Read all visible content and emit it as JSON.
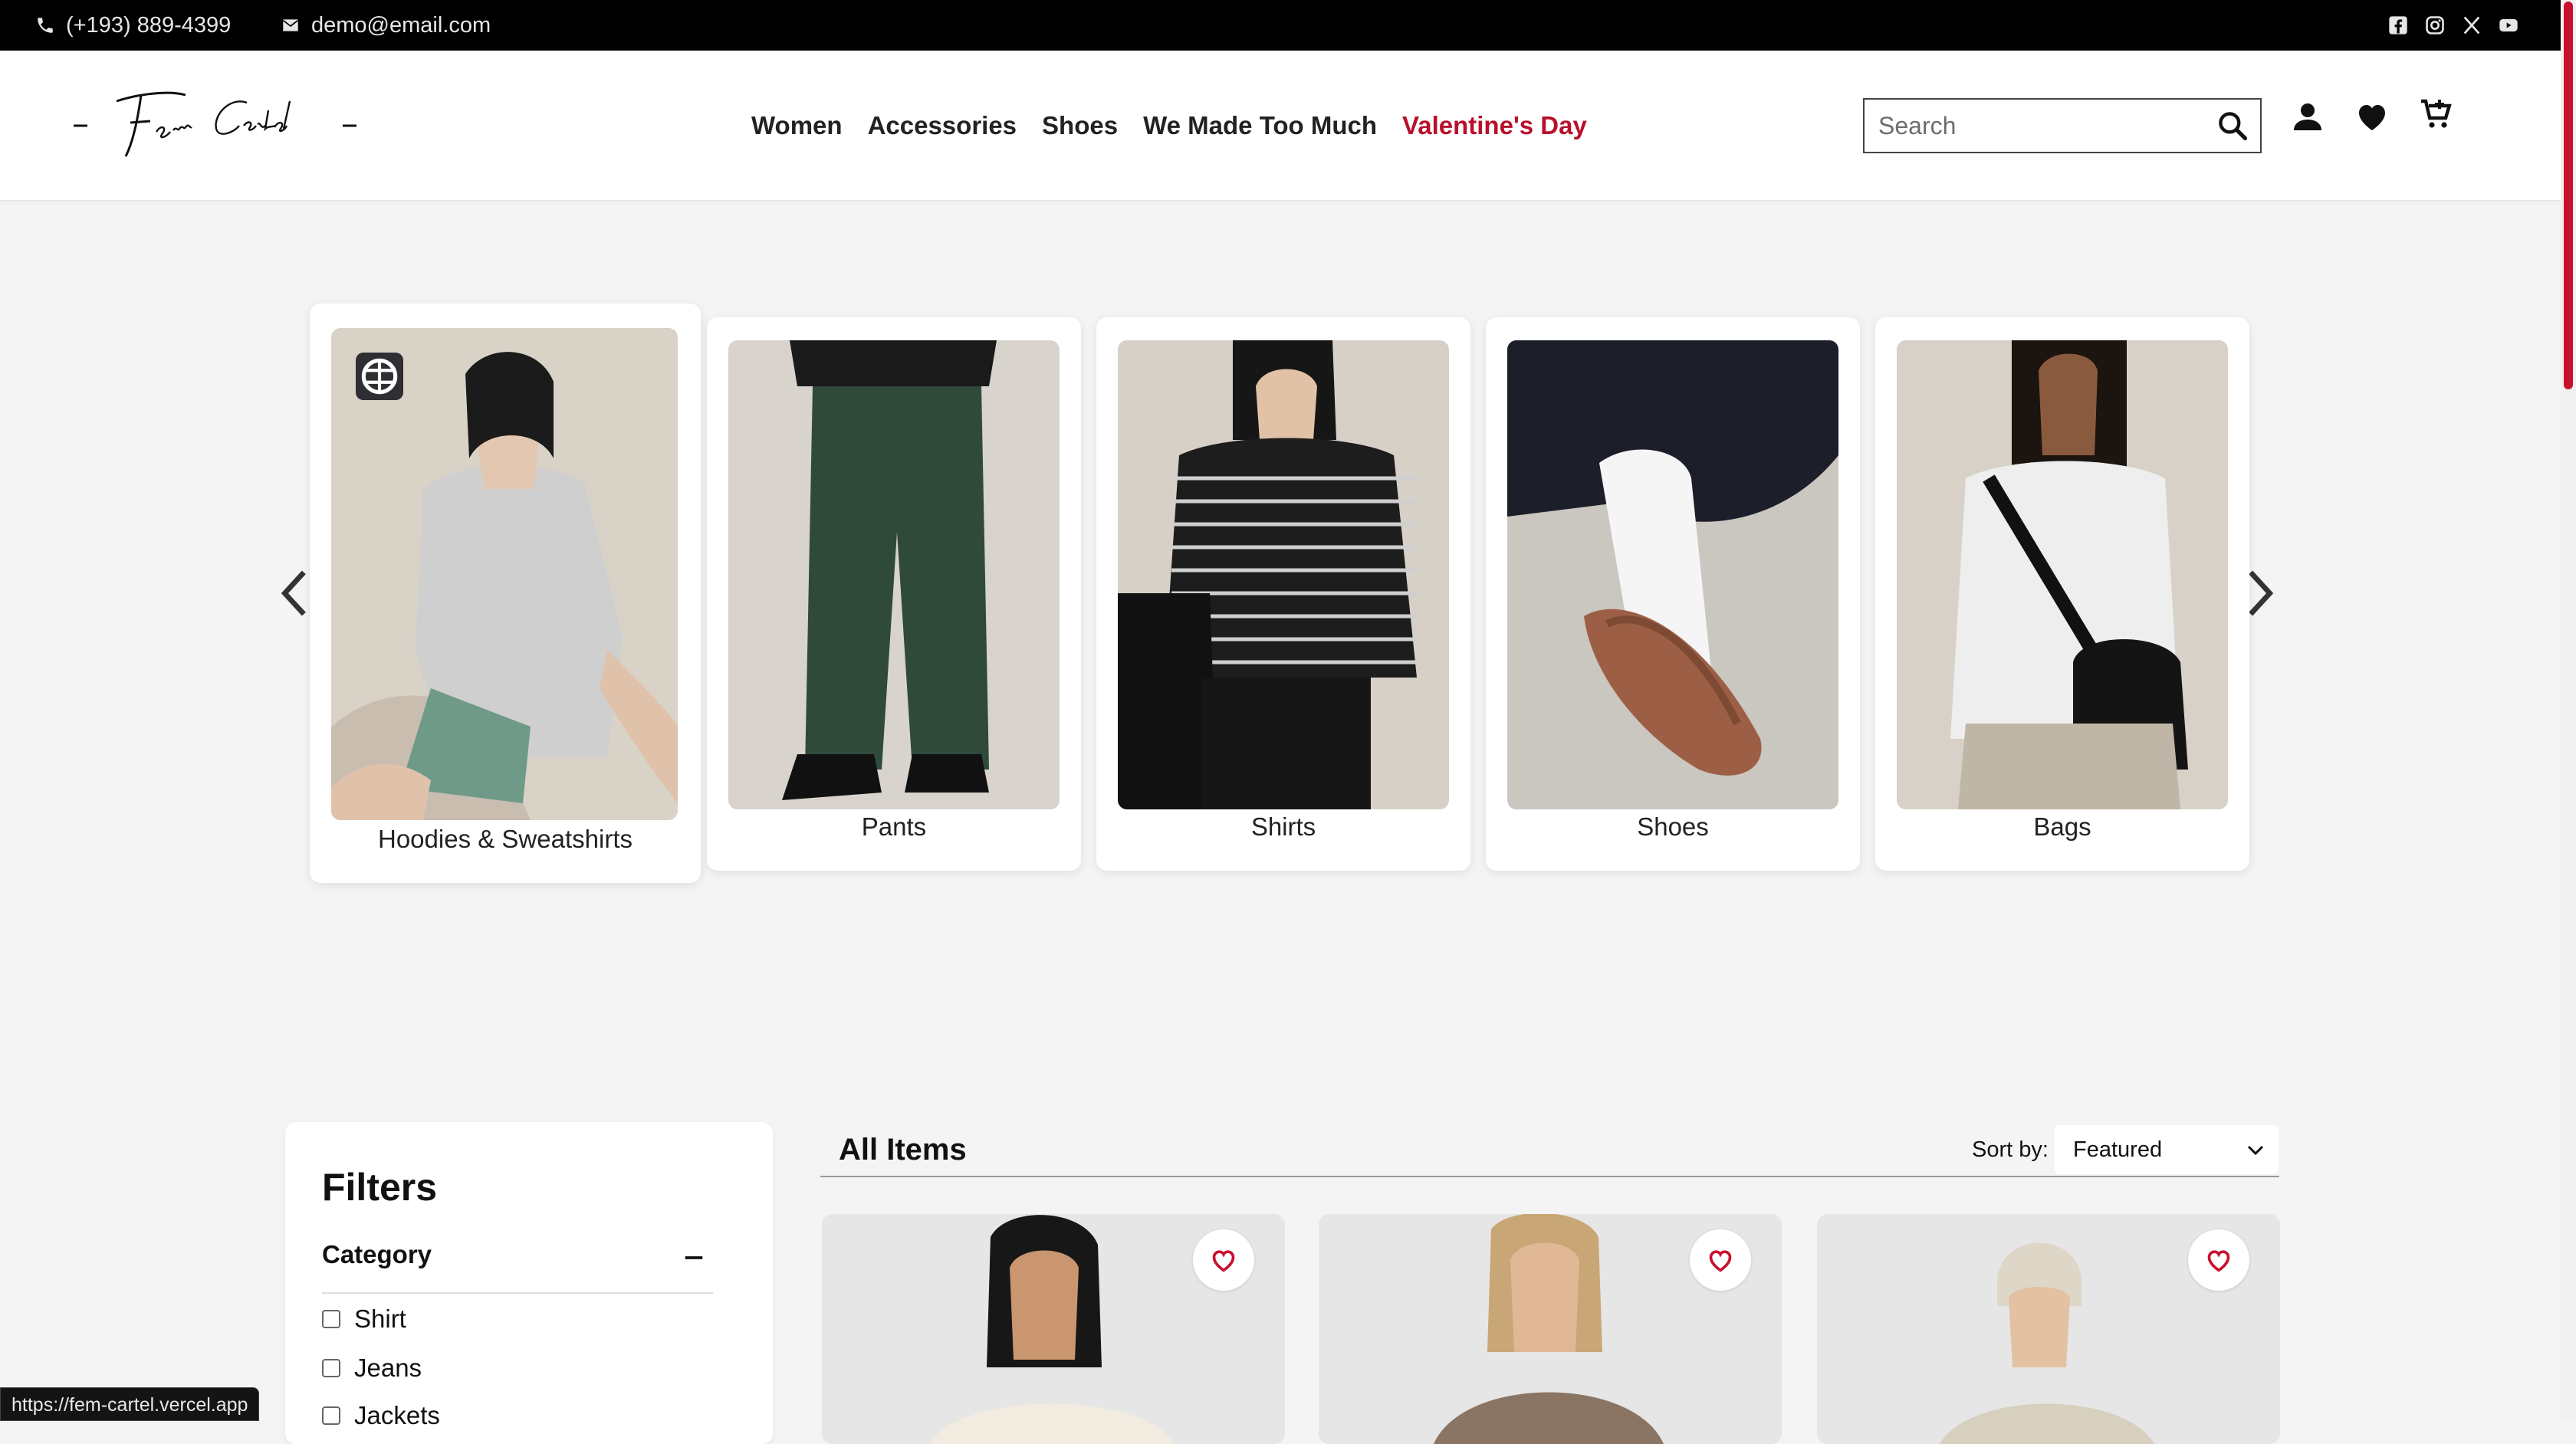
{
  "topbar": {
    "phone": "(+193) 889-4399",
    "email": "demo@email.com",
    "socials": [
      "facebook-icon",
      "instagram-icon",
      "x-icon",
      "youtube-icon"
    ]
  },
  "header": {
    "logo_text": "- Fem Cartel -",
    "nav": [
      "Women",
      "Accessories",
      "Shoes",
      "We Made Too Much",
      "Valentine's Day"
    ],
    "nav_accent_color": "#b8102b",
    "search_placeholder": "Search",
    "icons": [
      "search-icon",
      "account-icon",
      "wishlist-heart-icon",
      "cart-icon"
    ]
  },
  "categories": [
    {
      "label": "Hoodies & Sweatshirts"
    },
    {
      "label": "Pants"
    },
    {
      "label": "Shirts"
    },
    {
      "label": "Shoes"
    },
    {
      "label": "Bags"
    }
  ],
  "filters": {
    "title": "Filters",
    "category_heading": "Category",
    "options": [
      "Shirt",
      "Jeans",
      "Jackets"
    ]
  },
  "items": {
    "title": "All Items",
    "sort_label": "Sort by:",
    "sort_value": "Featured"
  },
  "status_url": "https://fem-cartel.vercel.app",
  "colors": {
    "brand_red": "#b8102b",
    "topbar_bg": "#000000",
    "page_bg": "#f4f4f4"
  }
}
